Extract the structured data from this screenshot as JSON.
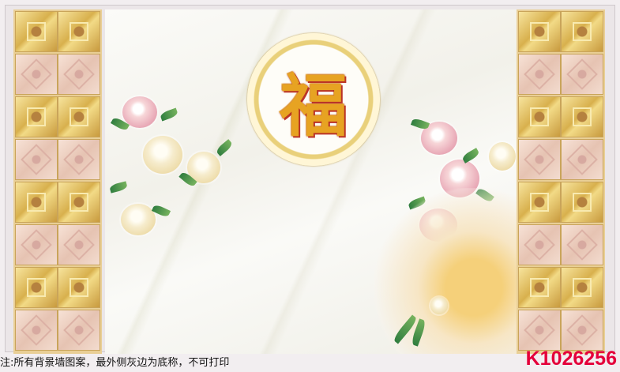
{
  "artwork": {
    "center_character": "福"
  },
  "footer": {
    "notice": "注:所有背景墙图案，最外侧灰边为底称，不可打印",
    "product_code": "K1026256"
  },
  "colors": {
    "code_red": "#e4003a",
    "gold": "#d8b04d",
    "rose_tile": "#e6c3b2",
    "marble": "#f6f5f0"
  }
}
